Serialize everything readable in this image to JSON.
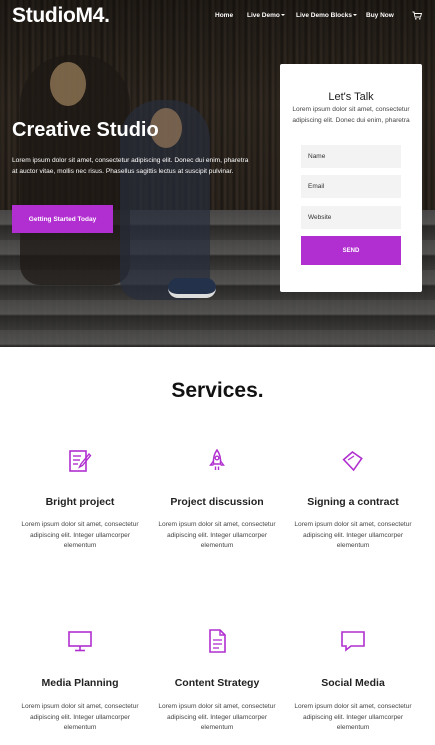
{
  "brand": {
    "logo": "StudioM4.",
    "accent": "#b12fd0"
  },
  "nav": {
    "home": "Home",
    "live_demo": "Live Demo",
    "live_demo_blocks": "Live Demo Blocks",
    "buy_now": "Buy Now",
    "cart_icon": "cart-icon"
  },
  "hero": {
    "title": "Creative Studio",
    "text_line1": "Lorem ipsum dolor sit amet, consectetur adipiscing elit. Donec dui enim, pharetra",
    "text_line2": "at auctor vitae, mollis nec risus. Phasellus sagittis lectus at suscipit pulvinar.",
    "cta": "Getting Started Today"
  },
  "contact": {
    "title": "Let's Talk",
    "text": "Lorem ipsum dolor sit amet, consectetur adipiscing elit. Donec dui enim, pharetra",
    "name_placeholder": "Name",
    "email_placeholder": "Email",
    "website_placeholder": "Website",
    "send": "SEND"
  },
  "services": {
    "title": "Services.",
    "items": [
      {
        "name": "Bright project",
        "icon": "edit-document-icon",
        "desc": "Lorem ipsum dolor sit amet, consectetur adipiscing elit. Integer ullamcorper elementum"
      },
      {
        "name": "Project discussion",
        "icon": "rocket-icon",
        "desc": "Lorem ipsum dolor sit amet, consectetur adipiscing elit. Integer ullamcorper elementum"
      },
      {
        "name": "Signing a contract",
        "icon": "ticket-icon",
        "desc": "Lorem ipsum dolor sit amet, consectetur adipiscing elit. Integer ullamcorper elementum"
      },
      {
        "name": "Media Planning",
        "icon": "monitor-icon",
        "desc": "Lorem ipsum dolor sit amet, consectetur adipiscing elit. Integer ullamcorper elementum"
      },
      {
        "name": "Content Strategy",
        "icon": "document-icon",
        "desc": "Lorem ipsum dolor sit amet, consectetur adipiscing elit. Integer ullamcorper elementum"
      },
      {
        "name": "Social Media",
        "icon": "chat-bubble-icon",
        "desc": "Lorem ipsum dolor sit amet, consectetur adipiscing elit. Integer ullamcorper elementum"
      }
    ]
  }
}
